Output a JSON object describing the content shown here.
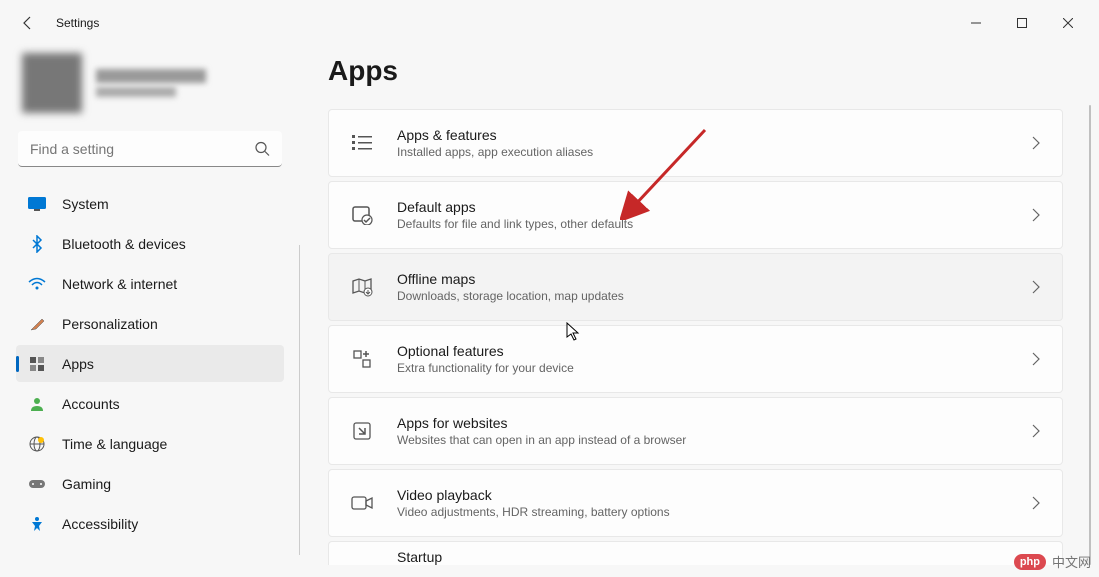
{
  "window": {
    "title": "Settings"
  },
  "search": {
    "placeholder": "Find a setting"
  },
  "sidebar": {
    "items": [
      {
        "label": "System",
        "icon": "display"
      },
      {
        "label": "Bluetooth & devices",
        "icon": "bluetooth"
      },
      {
        "label": "Network & internet",
        "icon": "wifi"
      },
      {
        "label": "Personalization",
        "icon": "brush"
      },
      {
        "label": "Apps",
        "icon": "grid",
        "selected": true
      },
      {
        "label": "Accounts",
        "icon": "person"
      },
      {
        "label": "Time & language",
        "icon": "globe"
      },
      {
        "label": "Gaming",
        "icon": "gamepad"
      },
      {
        "label": "Accessibility",
        "icon": "accessibility"
      }
    ]
  },
  "page": {
    "title": "Apps",
    "items": [
      {
        "title": "Apps & features",
        "desc": "Installed apps, app execution aliases",
        "icon": "list"
      },
      {
        "title": "Default apps",
        "desc": "Defaults for file and link types, other defaults",
        "icon": "default"
      },
      {
        "title": "Offline maps",
        "desc": "Downloads, storage location, map updates",
        "icon": "map",
        "hover": true
      },
      {
        "title": "Optional features",
        "desc": "Extra functionality for your device",
        "icon": "optional"
      },
      {
        "title": "Apps for websites",
        "desc": "Websites that can open in an app instead of a browser",
        "icon": "website"
      },
      {
        "title": "Video playback",
        "desc": "Video adjustments, HDR streaming, battery options",
        "icon": "video"
      },
      {
        "title": "Startup",
        "desc": "",
        "icon": "startup",
        "partial": true
      }
    ]
  },
  "watermark": {
    "badge": "php",
    "text": "中文网"
  }
}
